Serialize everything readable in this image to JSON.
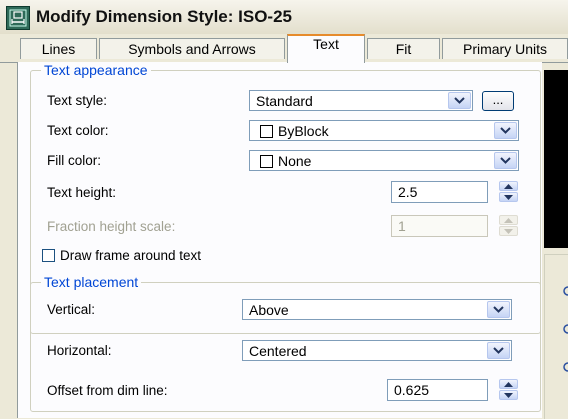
{
  "window": {
    "title": "Modify Dimension Style: ISO-25",
    "icon": "autocad-dimension-style-icon"
  },
  "tabs": [
    {
      "label": "Lines",
      "active": false
    },
    {
      "label": "Symbols and Arrows",
      "active": false
    },
    {
      "label": "Text",
      "active": true
    },
    {
      "label": "Fit",
      "active": false
    },
    {
      "label": "Primary Units",
      "active": false
    }
  ],
  "text_appearance": {
    "group_title": "Text appearance",
    "text_style": {
      "label": "Text style:",
      "value": "Standard",
      "browse_label": "..."
    },
    "text_color": {
      "label": "Text color:",
      "value": "ByBlock",
      "swatch": "#ffffff"
    },
    "fill_color": {
      "label": "Fill color:",
      "value": "None",
      "swatch": "#ffffff"
    },
    "text_height": {
      "label": "Text height:",
      "value": "2.5"
    },
    "fraction_height_scale": {
      "label": "Fraction height scale:",
      "value": "1",
      "enabled": false
    },
    "draw_frame": {
      "label": "Draw frame around text",
      "checked": false
    }
  },
  "text_placement": {
    "group_title": "Text placement",
    "vertical": {
      "label": "Vertical:",
      "value": "Above"
    },
    "horizontal": {
      "label": "Horizontal:",
      "value": "Centered"
    },
    "offset": {
      "label": "Offset from dim line:",
      "value": "0.625"
    }
  },
  "colors": {
    "dialog_bg": "#ece9d8",
    "panel_bg": "#fcfcfe",
    "group_title": "#0046d5",
    "active_tab_accent": "#e68b2c",
    "preview_bg": "#000000"
  }
}
